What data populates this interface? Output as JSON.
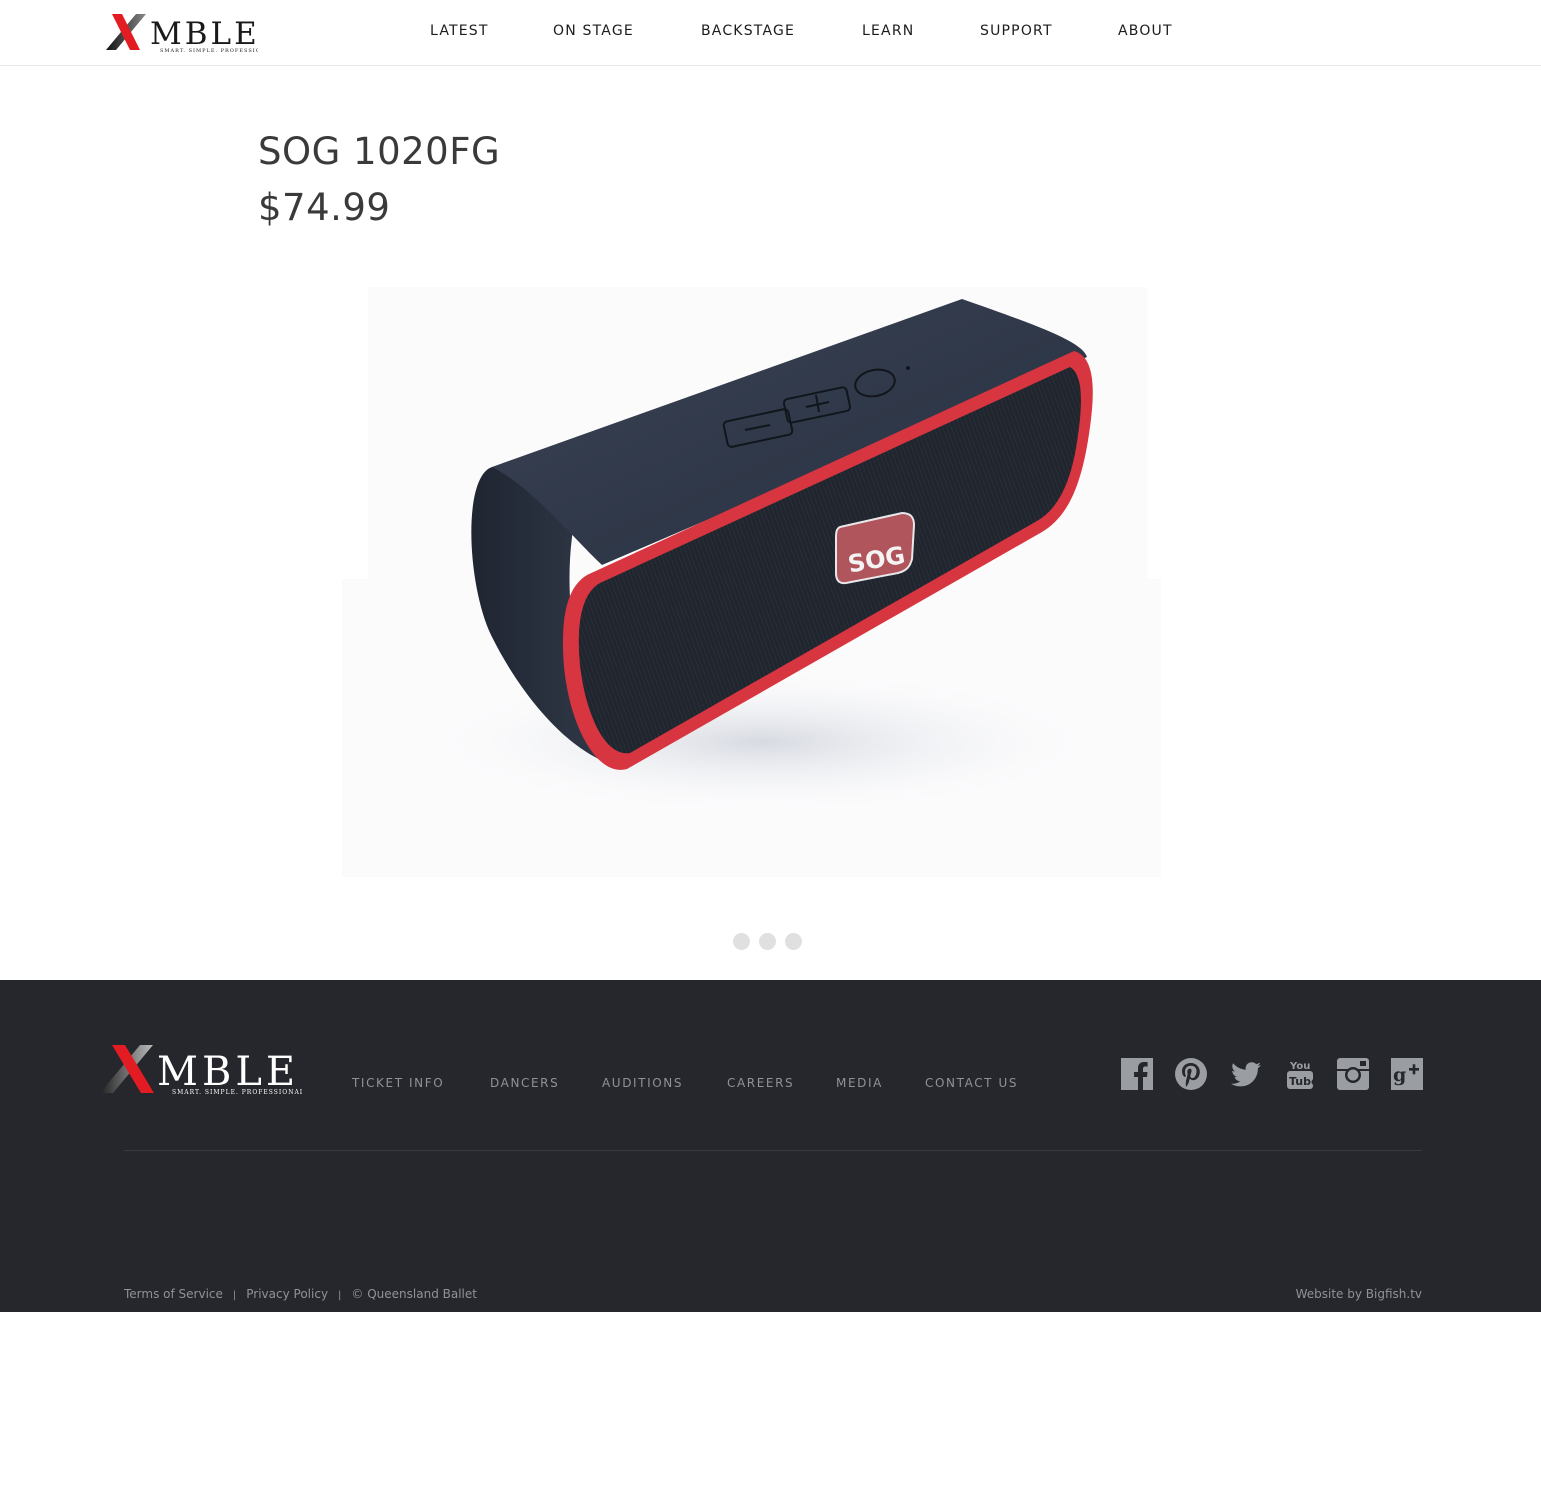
{
  "brand": {
    "logo_text": "XMBLE",
    "tagline": "SMART. SIMPLE. PROFESSIONAL.",
    "accent_color": "#e31b23"
  },
  "nav": {
    "items": [
      {
        "label": "LATEST"
      },
      {
        "label": "ON STAGE"
      },
      {
        "label": "BACKSTAGE"
      },
      {
        "label": "LEARN"
      },
      {
        "label": "SUPPORT"
      },
      {
        "label": "ABOUT"
      }
    ]
  },
  "product": {
    "title": "SOG 1020FG",
    "price": "$74.99",
    "image_icon": "bluetooth-speaker-image",
    "carousel_pages": 3
  },
  "footer": {
    "nav": [
      {
        "label": "TICKET INFO"
      },
      {
        "label": "DANCERS"
      },
      {
        "label": "AUDITIONS"
      },
      {
        "label": "CAREERS"
      },
      {
        "label": "MEDIA"
      },
      {
        "label": "CONTACT US"
      }
    ],
    "social": [
      {
        "name": "facebook-icon"
      },
      {
        "name": "pinterest-icon"
      },
      {
        "name": "twitter-icon"
      },
      {
        "name": "youtube-icon"
      },
      {
        "name": "instagram-icon"
      },
      {
        "name": "google-plus-icon"
      }
    ],
    "terms": "Terms of Service",
    "privacy": "Privacy Policy",
    "separator": "|",
    "copyright": "© Queensland Ballet",
    "credit": "Website by Bigfish.tv",
    "background": "#25272c"
  }
}
